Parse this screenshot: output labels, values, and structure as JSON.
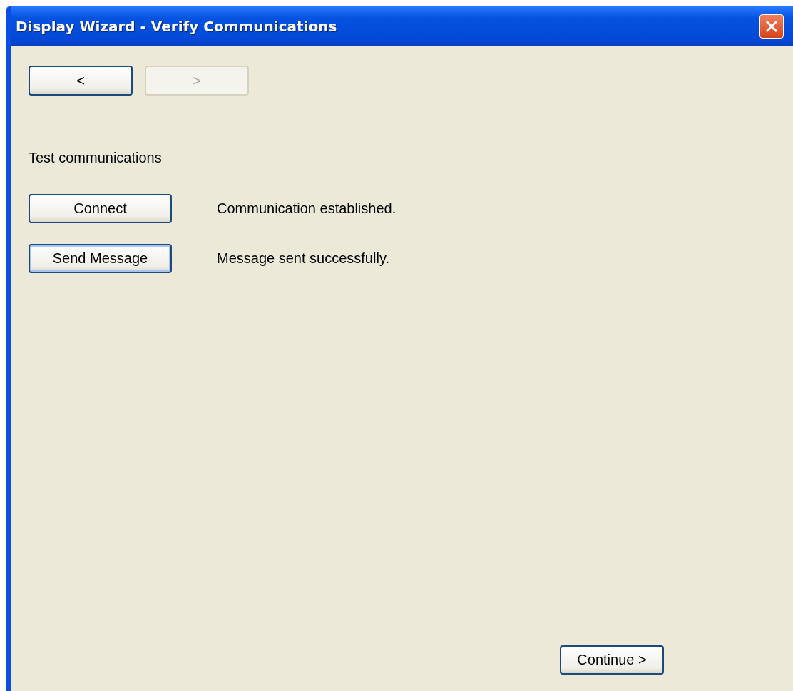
{
  "window": {
    "title": "Display Wizard - Verify Communications"
  },
  "nav_buttons": [
    {
      "label": "<",
      "disabled": false
    },
    {
      "label": ">",
      "disabled": true
    }
  ],
  "heading": "Test communications",
  "actions": [
    {
      "label": "Connect",
      "focused": false,
      "status": "Communication established."
    },
    {
      "label": "Send Message",
      "focused": true,
      "status": "Message sent successfully."
    }
  ],
  "continue_button": {
    "label": "Continue >"
  }
}
